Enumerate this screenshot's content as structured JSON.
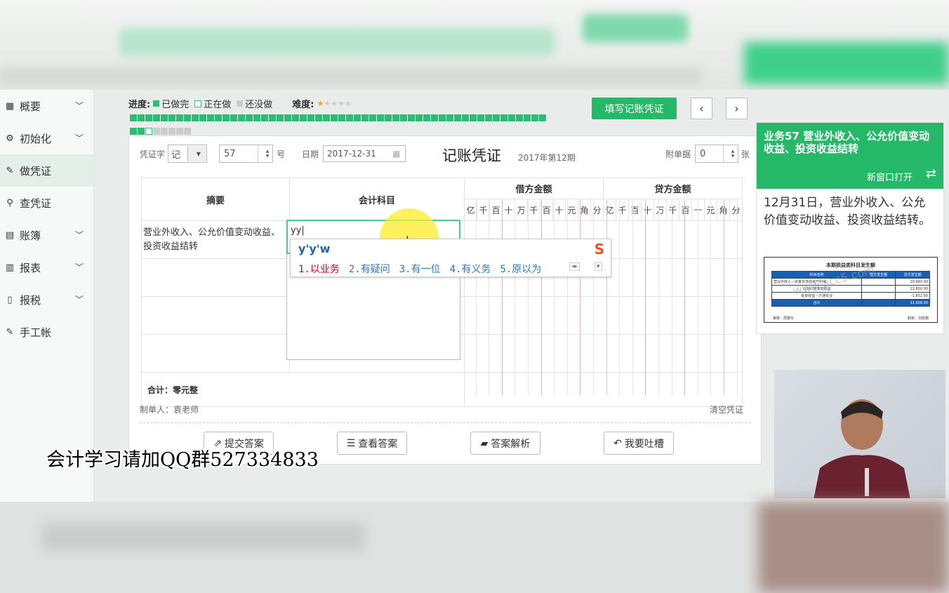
{
  "sidebar": {
    "items": [
      {
        "label": "概要",
        "icon": "grid-icon",
        "expandable": true
      },
      {
        "label": "初始化",
        "icon": "gear-icon",
        "expandable": true
      },
      {
        "label": "做凭证",
        "icon": "pen-icon",
        "expandable": false,
        "active": true
      },
      {
        "label": "查凭证",
        "icon": "search-icon",
        "expandable": false
      },
      {
        "label": "账簿",
        "icon": "book-icon",
        "expandable": true
      },
      {
        "label": "报表",
        "icon": "report-icon",
        "expandable": true
      },
      {
        "label": "报税",
        "icon": "document-icon",
        "expandable": true
      },
      {
        "label": "手工帐",
        "icon": "pen-icon",
        "expandable": false
      }
    ]
  },
  "progress": {
    "label": "进度:",
    "done_label": "已做完",
    "doing_label": "正在做",
    "todo_label": "还没做",
    "difficulty_label": "难度:",
    "difficulty_stars": 1,
    "difficulty_max": 5,
    "total_tasks": 62,
    "done_count": 56,
    "current_index": 57
  },
  "toolbar": {
    "fill_voucher_label": "填写记账凭证",
    "prev_icon": "chevron-left-icon",
    "next_icon": "chevron-right-icon"
  },
  "voucher": {
    "word_label": "凭证字",
    "word_value": "记",
    "number_value": "57",
    "number_suffix": "号",
    "date_label": "日期",
    "date_value": "2017-12-31",
    "title": "记账凭证",
    "period": "2017年第12期",
    "attach_label": "附单据",
    "attach_value": "0",
    "attach_suffix": "张",
    "headers": {
      "summary": "摘要",
      "account": "会计科目",
      "debit": "借方金额",
      "credit": "贷方金额"
    },
    "digit_units": [
      "亿",
      "千",
      "百",
      "十",
      "万",
      "千",
      "百",
      "十",
      "元",
      "角",
      "分"
    ],
    "rows": [
      {
        "summary": "营业外收入、公允价值变动收益、投资收益结转",
        "account": "yy"
      },
      {
        "summary": "",
        "account": ""
      },
      {
        "summary": "",
        "account": ""
      },
      {
        "summary": "",
        "account": ""
      }
    ],
    "total_label": "合计：零元整",
    "maker_label": "制单人：袁老师",
    "clear_label": "清空凭证"
  },
  "ime": {
    "composition": "y'y'w",
    "candidates": [
      "1.以业务",
      "2.有疑问",
      "3.有一位",
      "4.有义务",
      "5.原以为"
    ]
  },
  "actions": {
    "submit": "提交答案",
    "view": "查看答案",
    "analysis": "答案解析",
    "complain": "我要吐槽"
  },
  "task": {
    "title": "业务57 营业外收入、公允价值变动收益、投资收益结转",
    "open_new_window": "新窗口打开",
    "description": "12月31日，营业外收入、公允价值变动收益、投资收益结转。",
    "image": {
      "caption": "本期损益类科目发生额",
      "headers": [
        "科目名称",
        "借方发生额",
        "贷方发生额"
      ],
      "rows": [
        [
          "营业外收入－处置非流动资产利得",
          "",
          "20,640.00"
        ],
        [
          "公允价值变动损益",
          "",
          "12,800.00"
        ],
        [
          "投资收益－万通实业",
          "",
          "-1,832.00"
        ]
      ],
      "total": [
        "合计",
        "",
        "31,608.00"
      ],
      "reviewer": "审核：周雯玲",
      "maker": "制单：刘凯丽",
      "watermark": "www.acc5.com"
    }
  },
  "overlay_caption": "会计学习请加QQ群527334833",
  "colors": {
    "accent": "#25b868",
    "done": "#2bbd73",
    "ime_first": "#d0021b",
    "ime_other": "#2c79c6"
  }
}
